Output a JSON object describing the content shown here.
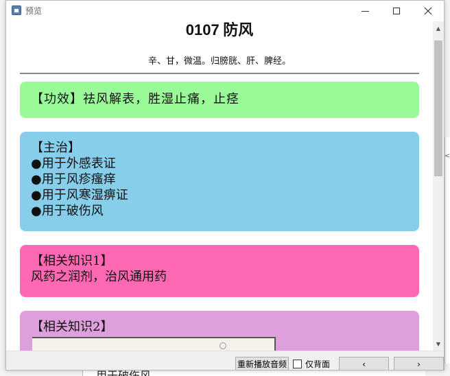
{
  "window": {
    "title": "预览"
  },
  "page": {
    "title_num": "0107",
    "title_name": "防风",
    "subtitle": "辛、甘，微温。归膀胱、肝、脾经。"
  },
  "cards": {
    "effect": {
      "text": "【功效】祛风解表，胜湿止痛，止痉",
      "color": "#98fb98"
    },
    "main": {
      "heading": "【主治】",
      "items": [
        "●用于外感表证",
        "●用于风疹瘙痒",
        "●用于风寒湿痹证",
        "●用于破伤风"
      ],
      "color": "#87ceeb"
    },
    "knowledge1": {
      "heading": "【相关知识1】",
      "text": "风药之润剂，治风通用药",
      "color": "#ff69b4"
    },
    "knowledge2": {
      "heading": "【相关知识2】",
      "color": "#dda0dd"
    }
  },
  "toolbar": {
    "replay_label": "重新播放音频",
    "background_only_label": "仅背面",
    "background_only_checked": false,
    "prev_label": "‹",
    "next_label": "›"
  },
  "background": {
    "partial_text": "用于破伤风"
  },
  "icons": {
    "app": "app-icon",
    "minimize": "minimize-icon",
    "maximize": "maximize-icon",
    "close": "close-icon",
    "scroll_up": "scroll-up-icon",
    "scroll_down": "scroll-down-icon"
  }
}
